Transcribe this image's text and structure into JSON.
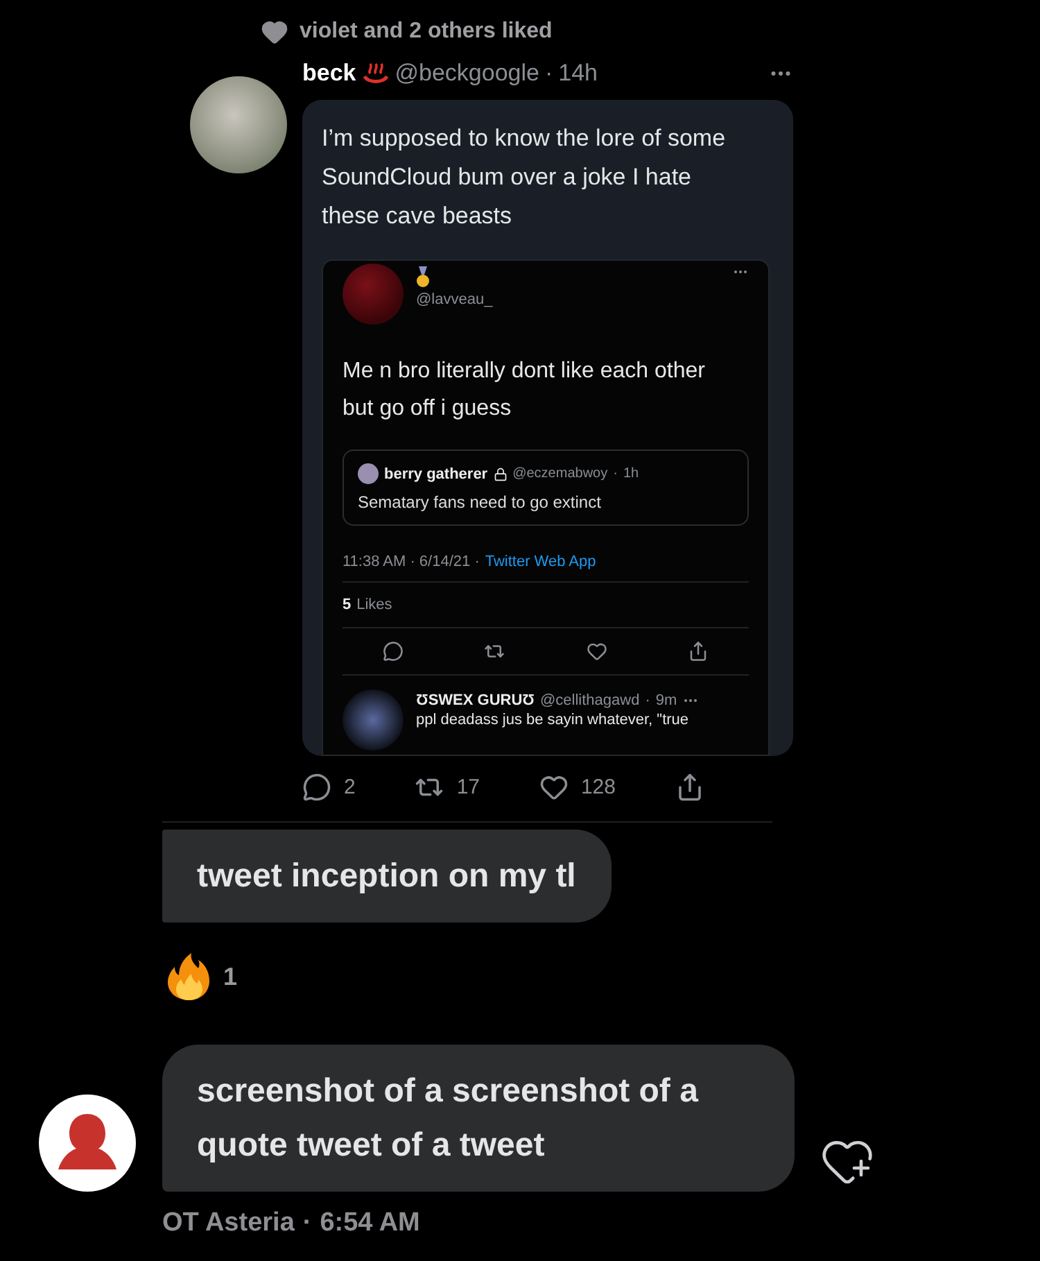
{
  "liked_banner": "violet and 2 others liked",
  "shared_tweet": {
    "name": "beck",
    "handle": "@beckgoogle",
    "separator": "·",
    "time": "14h",
    "text": "I’m supposed to know the lore of some SoundCloud bum over a joke I hate these cave beasts",
    "screenshot": {
      "handle": "@lavveau_",
      "text": "Me n bro literally dont like each other but go off i guess",
      "quote": {
        "name": "berry gatherer",
        "handle": "@eczemabwoy",
        "separator": "·",
        "time": "1h",
        "text": "Sematary fans need to go extinct"
      },
      "timestamp": "11:38 AM · 6/14/21 ·",
      "client": "Twitter Web App",
      "likes_count": "5",
      "likes_label": "Likes",
      "actions": [
        {
          "kind": "reply"
        },
        {
          "kind": "retweet"
        },
        {
          "kind": "like"
        },
        {
          "kind": "share"
        }
      ],
      "reply": {
        "name": "ƱSWEX GURUƱ",
        "handle": "@cellithagawd",
        "separator": "·",
        "time": "9m",
        "text": "ppl deadass jus be sayin whatever, \"true"
      }
    },
    "actions": [
      {
        "kind": "reply",
        "count": "2"
      },
      {
        "kind": "retweet",
        "count": "17"
      },
      {
        "kind": "like",
        "count": "128"
      },
      {
        "kind": "share"
      }
    ]
  },
  "messages": [
    {
      "text": "tweet inception on my tl",
      "reactions": [
        {
          "kind": "fire",
          "count": "1"
        }
      ]
    },
    {
      "text": "screenshot of a screenshot of a quote tweet of a tweet"
    }
  ],
  "sender": {
    "name": "OT Asteria",
    "separator": "·",
    "time": "6:54 AM"
  }
}
